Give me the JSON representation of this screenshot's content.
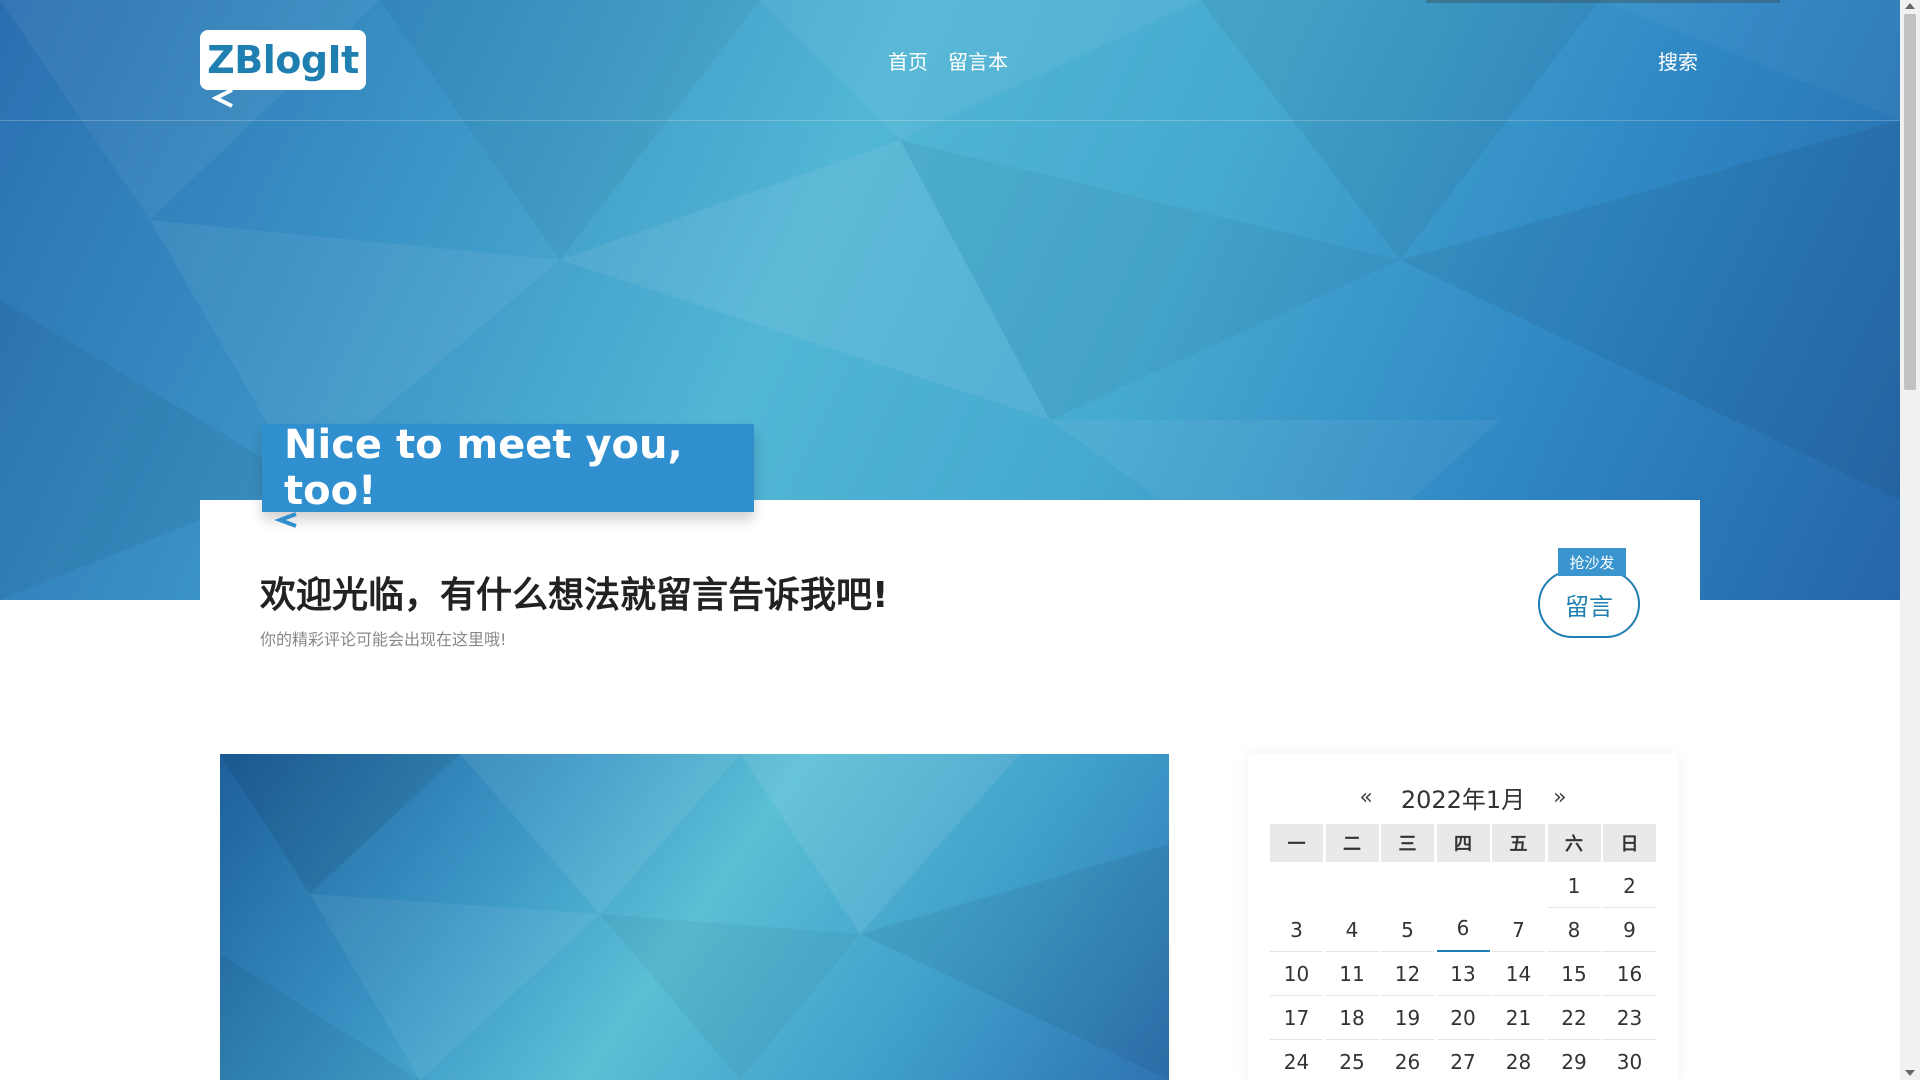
{
  "brand": {
    "logo_text": "ZBlogIt"
  },
  "nav": {
    "items": [
      {
        "label": "首页"
      },
      {
        "label": "留言本"
      }
    ],
    "search_label": "搜索"
  },
  "banner": {
    "text": "Nice to meet you, too!"
  },
  "page": {
    "title": "欢迎光临，有什么想法就留言告诉我吧!",
    "subtitle": "你的精彩评论可能会出现在这里哦!"
  },
  "reply": {
    "tag": "抢沙发",
    "button": "留言"
  },
  "calendar": {
    "prev": "«",
    "month_label": "2022年1月",
    "next": "»",
    "weekdays": [
      "一",
      "二",
      "三",
      "四",
      "五",
      "六",
      "日"
    ],
    "rows": [
      [
        "",
        "",
        "",
        "",
        "",
        "1",
        "2"
      ],
      [
        "3",
        "4",
        "5",
        "6",
        "7",
        "8",
        "9"
      ],
      [
        "10",
        "11",
        "12",
        "13",
        "14",
        "15",
        "16"
      ],
      [
        "17",
        "18",
        "19",
        "20",
        "21",
        "22",
        "23"
      ],
      [
        "24",
        "25",
        "26",
        "27",
        "28",
        "29",
        "30"
      ]
    ],
    "today": "6"
  },
  "colors": {
    "accent": "#1f7fb1",
    "banner": "#2f8fcf",
    "tag": "#3a95cf"
  }
}
